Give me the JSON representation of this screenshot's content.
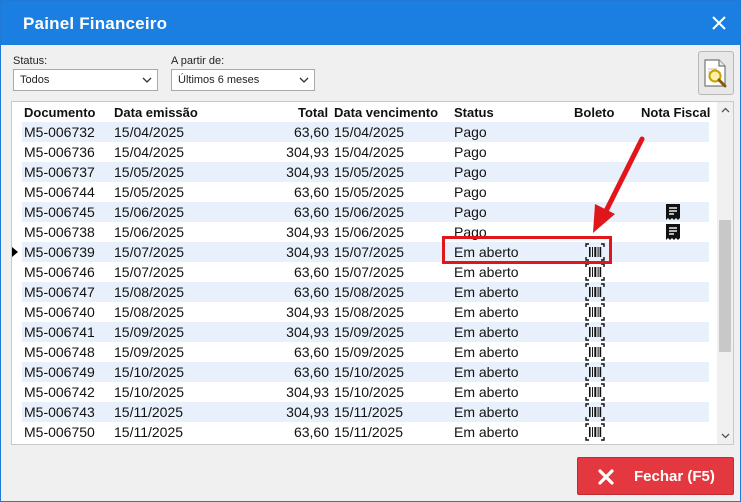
{
  "window": {
    "title": "Painel Financeiro"
  },
  "filters": {
    "status_label": "Status:",
    "status_value": "Todos",
    "period_label": "A partir de:",
    "period_value": "Últimos 6 meses"
  },
  "table": {
    "headers": [
      "Documento",
      "Data emissão",
      "Total",
      "Data vencimento",
      "Status",
      "Boleto",
      "Nota Fiscal"
    ],
    "rows": [
      {
        "doc": "M5-006732",
        "emissao": "15/04/2025",
        "total": "63,60",
        "venc": "15/04/2025",
        "status": "Pago",
        "boleto": false,
        "nfe": false
      },
      {
        "doc": "M5-006736",
        "emissao": "15/04/2025",
        "total": "304,93",
        "venc": "15/04/2025",
        "status": "Pago",
        "boleto": false,
        "nfe": false
      },
      {
        "doc": "M5-006737",
        "emissao": "15/05/2025",
        "total": "304,93",
        "venc": "15/05/2025",
        "status": "Pago",
        "boleto": false,
        "nfe": false
      },
      {
        "doc": "M5-006744",
        "emissao": "15/05/2025",
        "total": "63,60",
        "venc": "15/05/2025",
        "status": "Pago",
        "boleto": false,
        "nfe": false
      },
      {
        "doc": "M5-006745",
        "emissao": "15/06/2025",
        "total": "63,60",
        "venc": "15/06/2025",
        "status": "Pago",
        "boleto": false,
        "nfe": true
      },
      {
        "doc": "M5-006738",
        "emissao": "15/06/2025",
        "total": "304,93",
        "venc": "15/06/2025",
        "status": "Pago",
        "boleto": false,
        "nfe": true
      },
      {
        "doc": "M5-006739",
        "emissao": "15/07/2025",
        "total": "304,93",
        "venc": "15/07/2025",
        "status": "Em aberto",
        "boleto": true,
        "nfe": false,
        "current": true
      },
      {
        "doc": "M5-006746",
        "emissao": "15/07/2025",
        "total": "63,60",
        "venc": "15/07/2025",
        "status": "Em aberto",
        "boleto": true,
        "nfe": false
      },
      {
        "doc": "M5-006747",
        "emissao": "15/08/2025",
        "total": "63,60",
        "venc": "15/08/2025",
        "status": "Em aberto",
        "boleto": true,
        "nfe": false
      },
      {
        "doc": "M5-006740",
        "emissao": "15/08/2025",
        "total": "304,93",
        "venc": "15/08/2025",
        "status": "Em aberto",
        "boleto": true,
        "nfe": false
      },
      {
        "doc": "M5-006741",
        "emissao": "15/09/2025",
        "total": "304,93",
        "venc": "15/09/2025",
        "status": "Em aberto",
        "boleto": true,
        "nfe": false
      },
      {
        "doc": "M5-006748",
        "emissao": "15/09/2025",
        "total": "63,60",
        "venc": "15/09/2025",
        "status": "Em aberto",
        "boleto": true,
        "nfe": false
      },
      {
        "doc": "M5-006749",
        "emissao": "15/10/2025",
        "total": "63,60",
        "venc": "15/10/2025",
        "status": "Em aberto",
        "boleto": true,
        "nfe": false
      },
      {
        "doc": "M5-006742",
        "emissao": "15/10/2025",
        "total": "304,93",
        "venc": "15/10/2025",
        "status": "Em aberto",
        "boleto": true,
        "nfe": false
      },
      {
        "doc": "M5-006743",
        "emissao": "15/11/2025",
        "total": "304,93",
        "venc": "15/11/2025",
        "status": "Em aberto",
        "boleto": true,
        "nfe": false
      },
      {
        "doc": "M5-006750",
        "emissao": "15/11/2025",
        "total": "63,60",
        "venc": "15/11/2025",
        "status": "Em aberto",
        "boleto": true,
        "nfe": false
      }
    ]
  },
  "footer": {
    "close_label": "Fechar (F5)"
  },
  "colors": {
    "titlebar": "#1a7fe0",
    "accent_red": "#e0161b",
    "close_button": "#e3383f",
    "alt_row": "#e8f1fb"
  },
  "icons": {
    "close": "close-icon",
    "search_document": "search-document-icon",
    "barcode": "barcode-icon",
    "invoice": "invoice-icon"
  }
}
